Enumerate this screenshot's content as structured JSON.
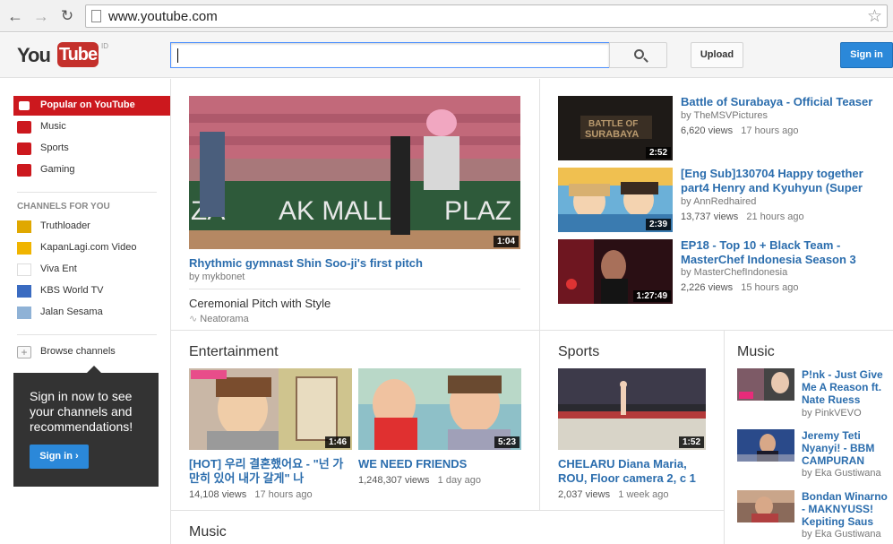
{
  "browser": {
    "url": "www.youtube.com"
  },
  "header": {
    "logo_you": "You",
    "logo_tube": "Tube",
    "region": "ID",
    "search_placeholder": "",
    "upload_label": "Upload",
    "signin_label": "Sign in"
  },
  "sidebar": {
    "items": [
      {
        "label": "Popular on YouTube",
        "icon": "popular-icon"
      },
      {
        "label": "Music",
        "icon": "headphones-icon"
      },
      {
        "label": "Sports",
        "icon": "trophy-icon"
      },
      {
        "label": "Gaming",
        "icon": "gamepad-icon"
      }
    ],
    "channels_heading": "CHANNELS FOR YOU",
    "channels": [
      {
        "label": "Truthloader"
      },
      {
        "label": "KapanLagi.com Video"
      },
      {
        "label": "Viva Ent"
      },
      {
        "label": "KBS World TV"
      },
      {
        "label": "Jalan Sesama"
      }
    ],
    "browse_label": "Browse channels",
    "promo_text": "Sign in now to see your channels and recommendations!",
    "promo_button": "Sign in ›"
  },
  "featured": {
    "duration": "1:04",
    "title": "Rhythmic gymnast Shin Soo-ji's first pitch",
    "by": "by mykbonet",
    "playlist_title": "Ceremonial Pitch with Style",
    "playlist_source": "Neatorama"
  },
  "side_videos": [
    {
      "title": "Battle of Surabaya - Official Teaser",
      "by": "by TheMSVPictures",
      "views": "6,620 views",
      "age": "17 hours ago",
      "duration": "2:52"
    },
    {
      "title": "[Eng Sub]130704 Happy together part4 Henry and Kyuhyun (Super",
      "by": "by AnnRedhaired",
      "views": "13,737 views",
      "age": "21 hours ago",
      "duration": "2:39"
    },
    {
      "title": "EP18 - Top 10 + Black Team - MasterChef Indonesia Season 3",
      "by": "by MasterChefIndonesia",
      "views": "2,226 views",
      "age": "15 hours ago",
      "duration": "1:27:49"
    }
  ],
  "entertainment": {
    "heading": "Entertainment",
    "videos": [
      {
        "title": "[HOT] 우리 결혼했어요 - \"넌 가만히 있어 내가 갈게\" 나",
        "views": "14,108 views",
        "age": "17 hours ago",
        "duration": "1:46"
      },
      {
        "title": "WE NEED FRIENDS",
        "views": "1,248,307 views",
        "age": "1 day ago",
        "duration": "5:23"
      }
    ]
  },
  "sports": {
    "heading": "Sports",
    "video": {
      "title": "CHELARU Diana Maria, ROU, Floor camera 2, c 1",
      "views": "2,037 views",
      "age": "1 week ago",
      "duration": "1:52"
    }
  },
  "music_right": {
    "heading": "Music",
    "videos": [
      {
        "title": "P!nk - Just Give Me A Reason ft. Nate Ruess",
        "by": "by PinkVEVO"
      },
      {
        "title": "Jeremy Teti Nyanyi! - BBM CAMPURAN",
        "by": "by Eka Gustiwana"
      },
      {
        "title": "Bondan Winarno - MAKNYUSS! Kepiting Saus",
        "by": "by Eka Gustiwana"
      }
    ]
  },
  "music_bottom": {
    "heading": "Music"
  }
}
